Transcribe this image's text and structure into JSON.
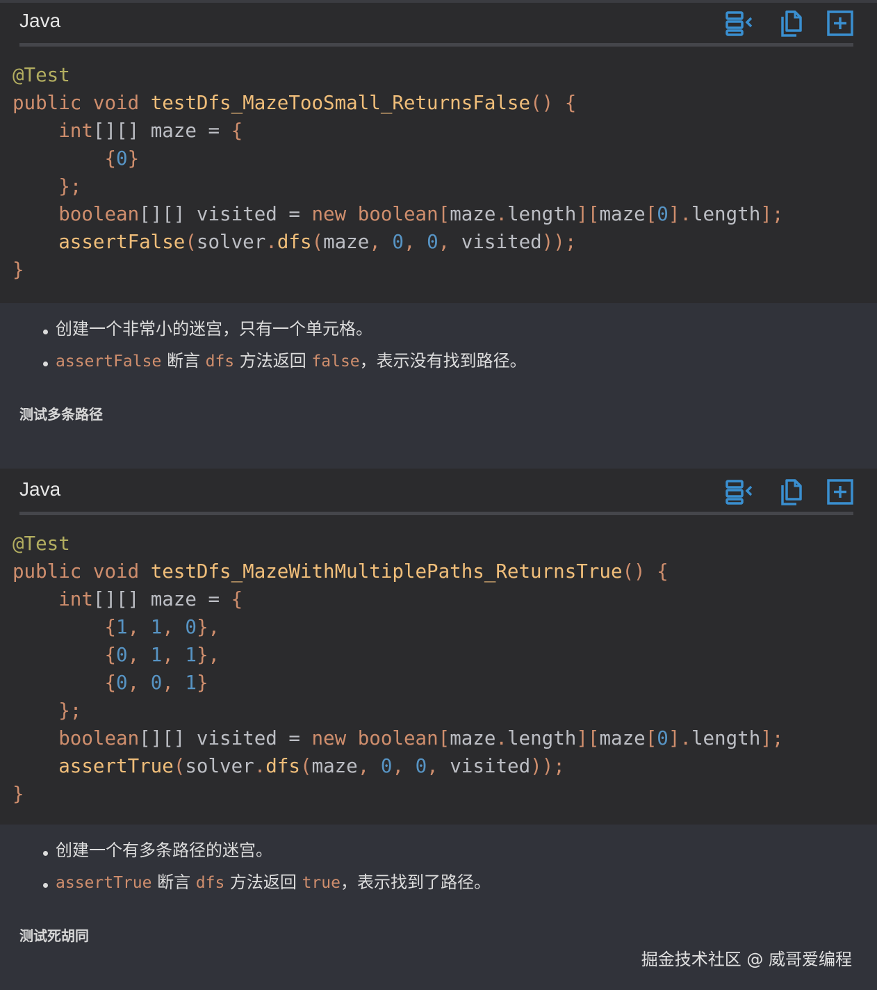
{
  "blocks": [
    {
      "language": "Java",
      "code_lines": [
        [
          [
            "ann",
            "@Test"
          ]
        ],
        [
          [
            "kw",
            "public void "
          ],
          [
            "fn",
            "testDfs_MazeTooSmall_ReturnsFalse"
          ],
          [
            "pun",
            "() {"
          ]
        ],
        [
          [
            "plain",
            "    "
          ],
          [
            "kw",
            "int"
          ],
          [
            "plain",
            "[][] maze = "
          ],
          [
            "pun",
            "{"
          ]
        ],
        [
          [
            "plain",
            "        "
          ],
          [
            "pun",
            "{"
          ],
          [
            "num",
            "0"
          ],
          [
            "pun",
            "}"
          ]
        ],
        [
          [
            "plain",
            "    "
          ],
          [
            "pun",
            "};"
          ]
        ],
        [
          [
            "plain",
            "    "
          ],
          [
            "kw",
            "boolean"
          ],
          [
            "plain",
            "[][] visited = "
          ],
          [
            "kw",
            "new boolean"
          ],
          [
            "pun",
            "["
          ],
          [
            "plain",
            "maze"
          ],
          [
            "pun",
            "."
          ],
          [
            "plain",
            "length"
          ],
          [
            "pun",
            "]["
          ],
          [
            "plain",
            "maze"
          ],
          [
            "pun",
            "["
          ],
          [
            "num",
            "0"
          ],
          [
            "pun",
            "]."
          ],
          [
            "plain",
            "length"
          ],
          [
            "pun",
            "];"
          ]
        ],
        [
          [
            "plain",
            "    "
          ],
          [
            "fn",
            "assertFalse"
          ],
          [
            "pun",
            "("
          ],
          [
            "plain",
            "solver"
          ],
          [
            "pun",
            "."
          ],
          [
            "fn",
            "dfs"
          ],
          [
            "pun",
            "("
          ],
          [
            "plain",
            "maze"
          ],
          [
            "pun",
            ", "
          ],
          [
            "num",
            "0"
          ],
          [
            "pun",
            ", "
          ],
          [
            "num",
            "0"
          ],
          [
            "pun",
            ", "
          ],
          [
            "plain",
            "visited"
          ],
          [
            "pun",
            "));"
          ]
        ],
        [
          [
            "pun",
            "}"
          ]
        ]
      ],
      "bullets": [
        [
          [
            "text",
            "创建一个非常小的迷宫，只有一个单元格。"
          ]
        ],
        [
          [
            "code",
            "assertFalse"
          ],
          [
            "text",
            " 断言 "
          ],
          [
            "code",
            "dfs"
          ],
          [
            "text",
            " 方法返回 "
          ],
          [
            "code",
            "false"
          ],
          [
            "text",
            "，表示没有找到路径。"
          ]
        ]
      ],
      "next_heading": "测试多条路径"
    },
    {
      "language": "Java",
      "code_lines": [
        [
          [
            "ann",
            "@Test"
          ]
        ],
        [
          [
            "kw",
            "public void "
          ],
          [
            "fn",
            "testDfs_MazeWithMultiplePaths_ReturnsTrue"
          ],
          [
            "pun",
            "() {"
          ]
        ],
        [
          [
            "plain",
            "    "
          ],
          [
            "kw",
            "int"
          ],
          [
            "plain",
            "[][] maze = "
          ],
          [
            "pun",
            "{"
          ]
        ],
        [
          [
            "plain",
            "        "
          ],
          [
            "pun",
            "{"
          ],
          [
            "num",
            "1"
          ],
          [
            "pun",
            ", "
          ],
          [
            "num",
            "1"
          ],
          [
            "pun",
            ", "
          ],
          [
            "num",
            "0"
          ],
          [
            "pun",
            "},"
          ]
        ],
        [
          [
            "plain",
            "        "
          ],
          [
            "pun",
            "{"
          ],
          [
            "num",
            "0"
          ],
          [
            "pun",
            ", "
          ],
          [
            "num",
            "1"
          ],
          [
            "pun",
            ", "
          ],
          [
            "num",
            "1"
          ],
          [
            "pun",
            "},"
          ]
        ],
        [
          [
            "plain",
            "        "
          ],
          [
            "pun",
            "{"
          ],
          [
            "num",
            "0"
          ],
          [
            "pun",
            ", "
          ],
          [
            "num",
            "0"
          ],
          [
            "pun",
            ", "
          ],
          [
            "num",
            "1"
          ],
          [
            "pun",
            "}"
          ]
        ],
        [
          [
            "plain",
            "    "
          ],
          [
            "pun",
            "};"
          ]
        ],
        [
          [
            "plain",
            "    "
          ],
          [
            "kw",
            "boolean"
          ],
          [
            "plain",
            "[][] visited = "
          ],
          [
            "kw",
            "new boolean"
          ],
          [
            "pun",
            "["
          ],
          [
            "plain",
            "maze"
          ],
          [
            "pun",
            "."
          ],
          [
            "plain",
            "length"
          ],
          [
            "pun",
            "]["
          ],
          [
            "plain",
            "maze"
          ],
          [
            "pun",
            "["
          ],
          [
            "num",
            "0"
          ],
          [
            "pun",
            "]."
          ],
          [
            "plain",
            "length"
          ],
          [
            "pun",
            "];"
          ]
        ],
        [
          [
            "plain",
            "    "
          ],
          [
            "fn",
            "assertTrue"
          ],
          [
            "pun",
            "("
          ],
          [
            "plain",
            "solver"
          ],
          [
            "pun",
            "."
          ],
          [
            "fn",
            "dfs"
          ],
          [
            "pun",
            "("
          ],
          [
            "plain",
            "maze"
          ],
          [
            "pun",
            ", "
          ],
          [
            "num",
            "0"
          ],
          [
            "pun",
            ", "
          ],
          [
            "num",
            "0"
          ],
          [
            "pun",
            ", "
          ],
          [
            "plain",
            "visited"
          ],
          [
            "pun",
            "));"
          ]
        ],
        [
          [
            "pun",
            "}"
          ]
        ]
      ],
      "bullets": [
        [
          [
            "text",
            "创建一个有多条路径的迷宫。"
          ]
        ],
        [
          [
            "code",
            "assertTrue"
          ],
          [
            "text",
            " 断言 "
          ],
          [
            "code",
            "dfs"
          ],
          [
            "text",
            " 方法返回 "
          ],
          [
            "code",
            "true"
          ],
          [
            "text",
            "，表示找到了路径。"
          ]
        ]
      ],
      "next_heading": "测试死胡同"
    }
  ],
  "toolbar_icons": [
    "wrap-lines-icon",
    "copy-icon",
    "expand-icon"
  ],
  "watermark": "掘金技术社区 @ 威哥爱编程",
  "colors": {
    "page_bg": "#31333a",
    "code_bg": "#2b2b2d",
    "keyword": "#cf8e6d",
    "function": "#f0be7a",
    "annotation": "#b3ae60",
    "number": "#5794c4",
    "icon": "#3a8fd0"
  }
}
